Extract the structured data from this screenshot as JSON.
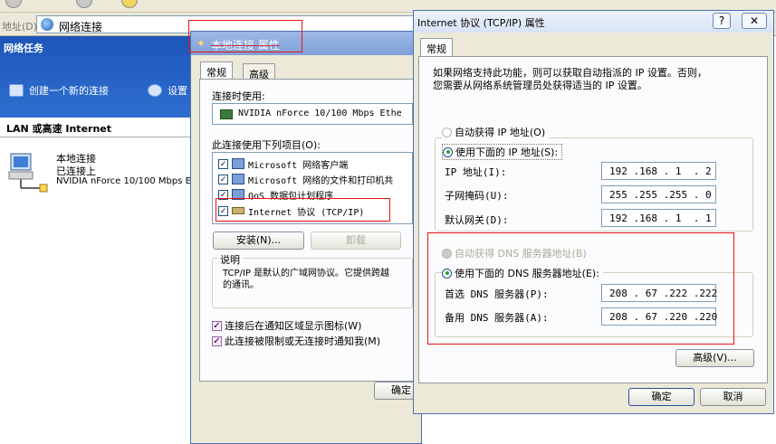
{
  "explorer": {
    "toolbar_circles": 3,
    "address_label": "地址(D)",
    "address_value": "网络连接",
    "network_tasks_title": "网络任务",
    "task_create": "创建一个新的连接",
    "task_settings": "设置",
    "lan_section_title": "LAN 或高速 Internet",
    "connection": {
      "name": "本地连接",
      "status": "已连接上",
      "device": "NVIDIA nForce 10/100 Mbps E..."
    }
  },
  "props_window": {
    "title": "本地连接 属性",
    "tabs": [
      "常规",
      "高级"
    ],
    "connect_using_label": "连接时使用:",
    "adapter": "NVIDIA nForce 10/100 Mbps Ethe",
    "items_label": "此连接使用下列项目(O):",
    "items": [
      {
        "label": "Microsoft 网络客户端",
        "checked": true
      },
      {
        "label": "Microsoft 网络的文件和打印机共",
        "checked": true
      },
      {
        "label": "QoS 数据包计划程序",
        "checked": true
      },
      {
        "label": "Internet 协议 (TCP/IP)",
        "checked": true
      }
    ],
    "install_button": "安装(N)...",
    "uninstall_button": "卸载",
    "description_legend": "说明",
    "description_text": "TCP/IP 是默认的广域网协议。它提供跨越\n的通讯。",
    "show_icon_label": "连接后在通知区域显示图标(W)",
    "notify_label": "此连接被限制或无连接时通知我(M)",
    "ok_button": "确定"
  },
  "tcp_dialog": {
    "title": "Internet 协议 (TCP/IP) 属性",
    "help_button": "?",
    "close_button": "✕",
    "tab": "常规",
    "intro": "如果网络支持此功能，则可以获取自动指派的 IP 设置。否则，\n您需要从网络系统管理员处获得适当的 IP 设置。",
    "auto_ip_label": "自动获得 IP 地址(O)",
    "manual_ip_label": "使用下面的 IP 地址(S):",
    "ip_label": "IP 地址(I):",
    "ip_value": "192 .168 . 1  . 2",
    "mask_label": "子网掩码(U):",
    "mask_value": "255 .255 .255 . 0",
    "gateway_label": "默认网关(D):",
    "gateway_value": "192 .168 . 1  . 1",
    "auto_dns_label": "自动获得 DNS 服务器地址(B)",
    "manual_dns_label": "使用下面的 DNS 服务器地址(E):",
    "preferred_dns_label": "首选 DNS 服务器(P):",
    "preferred_dns_value": "208 . 67 .222 .222",
    "alternate_dns_label": "备用 DNS 服务器(A):",
    "alternate_dns_value": "208 . 67 .220 .220",
    "advanced_button": "高级(V)...",
    "ok_button": "确定",
    "cancel_button": "取消"
  },
  "colors": {
    "annotation_red": "#e11111",
    "xp_blue": "#1d55b8",
    "dialog_bg": "#ece9d8"
  }
}
